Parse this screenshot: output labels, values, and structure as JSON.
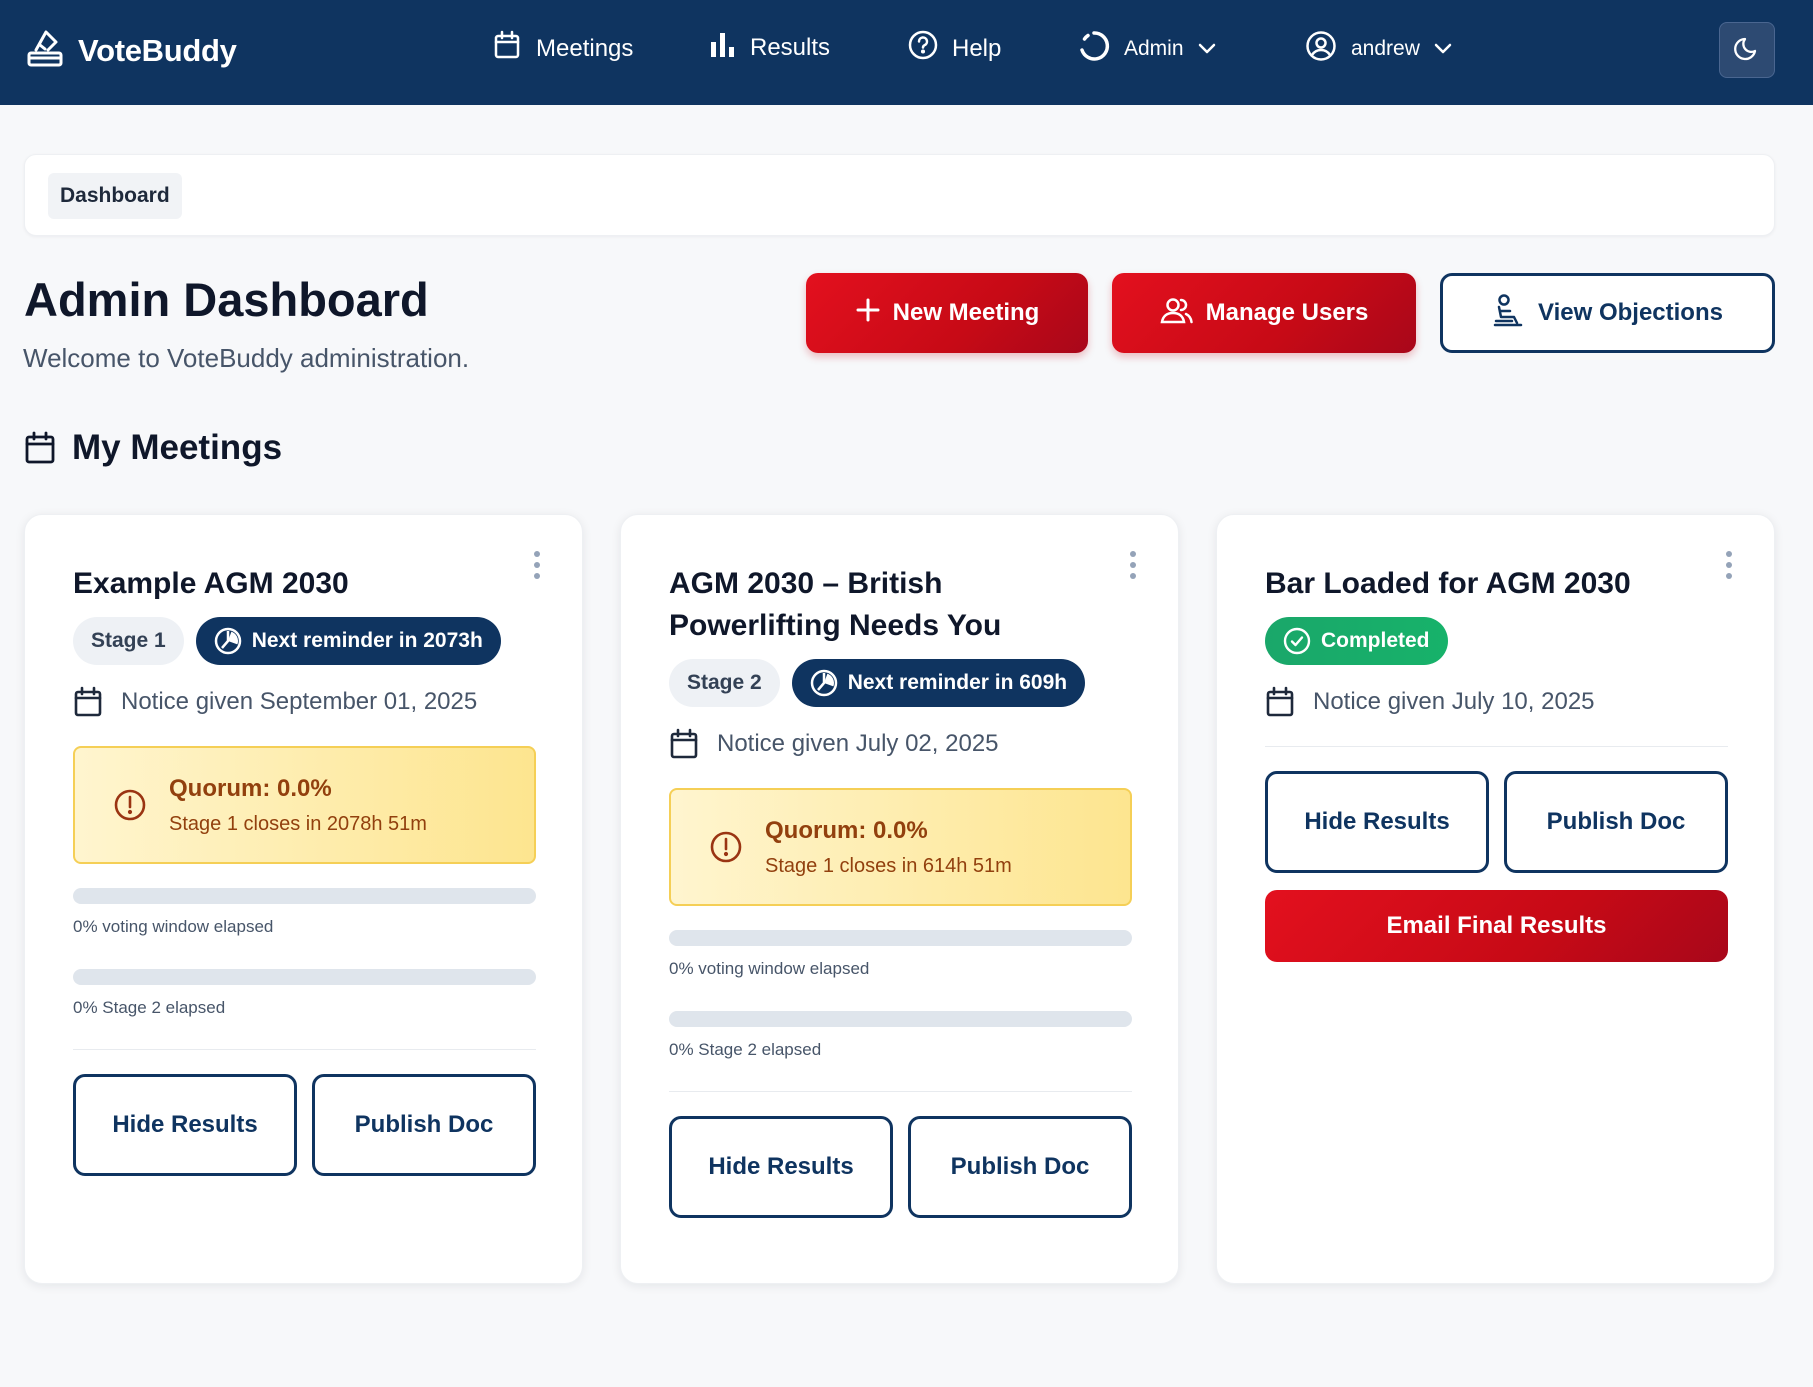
{
  "navbar": {
    "brand": "VoteBuddy",
    "items": [
      {
        "label": "Meetings",
        "icon": "calendar-icon"
      },
      {
        "label": "Results",
        "icon": "bar-chart-icon"
      },
      {
        "label": "Help",
        "icon": "help-circle-icon"
      }
    ],
    "admin_menu": "Admin",
    "user_menu": "andrew",
    "theme_toggle_icon": "moon-icon"
  },
  "breadcrumb": [
    "Dashboard"
  ],
  "header": {
    "title": "Admin Dashboard",
    "subtitle": "Welcome to VoteBuddy administration.",
    "actions": {
      "new_meeting": "New Meeting",
      "manage_users": "Manage Users",
      "view_objections": "View Objections"
    }
  },
  "section": {
    "title": "My Meetings"
  },
  "meetings": [
    {
      "title": "Example AGM 2030",
      "stage": "Stage 1",
      "reminder": "Next reminder in 2073h",
      "notice": "Notice given September 01, 2025",
      "quorum_title": "Quorum: 0.0%",
      "quorum_sub": "Stage 1 closes in 2078h 51m",
      "voting_window_progress": 0,
      "voting_window_label": "0% voting window elapsed",
      "stage2_progress": 0,
      "stage2_label": "0% Stage 2 elapsed",
      "buttons": {
        "hide": "Hide Results",
        "publish": "Publish Doc"
      }
    },
    {
      "title": "AGM 2030 – British Powerlifting Needs You",
      "stage": "Stage 2",
      "reminder": "Next reminder in 609h",
      "notice": "Notice given July 02, 2025",
      "quorum_title": "Quorum: 0.0%",
      "quorum_sub": "Stage 1 closes in 614h 51m",
      "voting_window_progress": 0,
      "voting_window_label": "0% voting window elapsed",
      "stage2_progress": 0,
      "stage2_label": "0% Stage 2 elapsed",
      "buttons": {
        "hide": "Hide Results",
        "publish": "Publish Doc"
      }
    },
    {
      "title": "Bar Loaded for AGM 2030",
      "status": "Completed",
      "notice": "Notice given July 10, 2025",
      "buttons": {
        "hide": "Hide Results",
        "publish": "Publish Doc",
        "email": "Email Final Results"
      }
    }
  ],
  "colors": {
    "navy": "#0f3460",
    "red": "#c70a16",
    "green": "#17b26a",
    "warning_bg": "#fde58f",
    "warning_text": "#92400e"
  }
}
